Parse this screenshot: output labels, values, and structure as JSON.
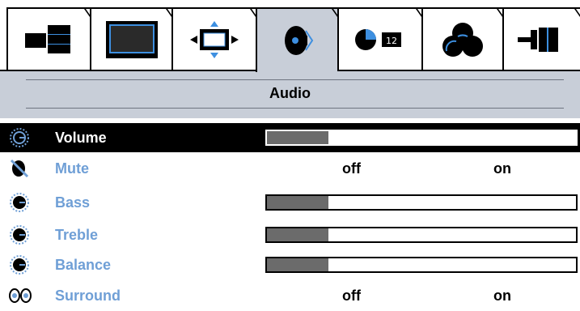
{
  "tabs": [
    {
      "icon": "layout-blocks-icon"
    },
    {
      "icon": "monitor-icon"
    },
    {
      "icon": "position-arrows-icon"
    },
    {
      "icon": "speaker-icon",
      "active": true
    },
    {
      "icon": "clock-timer-icon"
    },
    {
      "icon": "color-circles-icon"
    },
    {
      "icon": "connector-icon"
    }
  ],
  "header": {
    "title": "Audio"
  },
  "rows": [
    {
      "label": "Volume",
      "icon": "volume-dial-icon",
      "type": "slider",
      "value": 0.2,
      "selected": true
    },
    {
      "label": "Mute",
      "icon": "mute-speaker-icon",
      "type": "toggle",
      "off_label": "off",
      "on_label": "on"
    },
    {
      "label": "Bass",
      "icon": "bass-dial-icon",
      "type": "slider",
      "value": 0.2
    },
    {
      "label": "Treble",
      "icon": "treble-dial-icon",
      "type": "slider",
      "value": 0.2
    },
    {
      "label": "Balance",
      "icon": "balance-dial-icon",
      "type": "slider",
      "value": 0.2
    },
    {
      "label": "Surround",
      "icon": "surround-icon",
      "type": "toggle",
      "off_label": "off",
      "on_label": "on"
    }
  ],
  "colors": {
    "accent": "#6f9fd6",
    "panel": "#c8ced8",
    "fill": "#6b6b6b"
  }
}
